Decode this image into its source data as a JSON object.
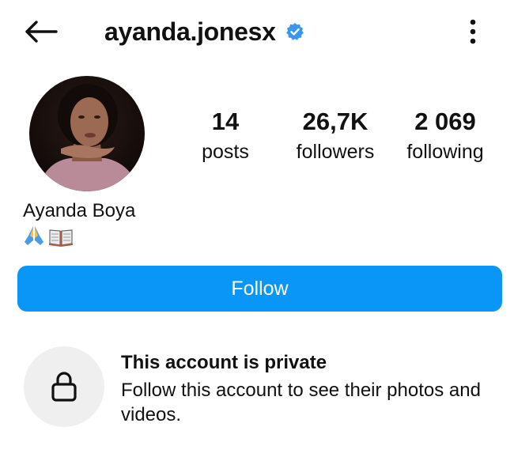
{
  "header": {
    "username": "ayanda.jonesx",
    "back_icon": "arrow-left-icon",
    "verified_icon": "verified-badge-icon",
    "verified_color": "#3897f0",
    "more_icon": "more-vertical-icon"
  },
  "profile": {
    "avatar_icon": "profile-photo",
    "display_name": "Ayanda Boya",
    "bio_emojis": [
      "folded-hands-emoji",
      "open-book-emoji"
    ]
  },
  "stats": [
    {
      "value": "14",
      "label": "posts"
    },
    {
      "value": "26,7K",
      "label": "followers"
    },
    {
      "value": "2 069",
      "label": "following"
    }
  ],
  "actions": {
    "follow_label": "Follow",
    "follow_color": "#0a96f6"
  },
  "private_notice": {
    "icon": "lock-icon",
    "title": "This account is private",
    "description": "Follow this account to see their photos and videos."
  }
}
